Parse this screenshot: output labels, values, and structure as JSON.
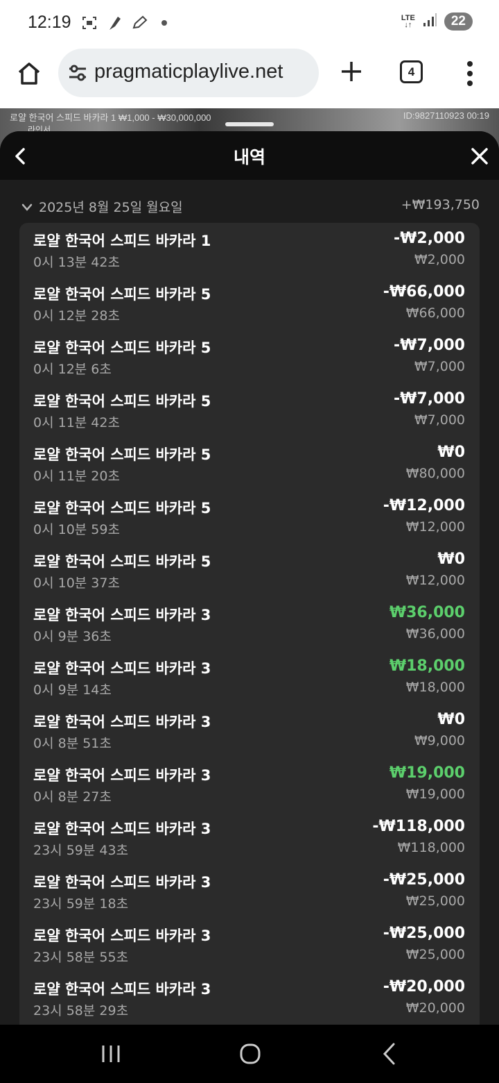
{
  "status_bar": {
    "time": "12:19",
    "network": "LTE",
    "battery": "22"
  },
  "browser": {
    "url": "pragmaticplaylive.net",
    "tab_count": "4"
  },
  "game": {
    "info": "로얄 한국어 스피드 바카라 1  ₩1,000 - ₩30,000,000",
    "id": "ID:9827110923  00:19",
    "sub": "라인서"
  },
  "sheet": {
    "title": "내역",
    "day": {
      "label": "2025년 8월 25일 월요일",
      "total": "+₩193,750"
    },
    "items": [
      {
        "name": "로얄 한국어 스피드 바카라 1",
        "time": "0시 13분 42초",
        "amount": "-₩2,000",
        "stake": "₩2,000",
        "win": false
      },
      {
        "name": "로얄 한국어 스피드 바카라 5",
        "time": "0시 12분 28초",
        "amount": "-₩66,000",
        "stake": "₩66,000",
        "win": false
      },
      {
        "name": "로얄 한국어 스피드 바카라 5",
        "time": "0시 12분 6초",
        "amount": "-₩7,000",
        "stake": "₩7,000",
        "win": false
      },
      {
        "name": "로얄 한국어 스피드 바카라 5",
        "time": "0시 11분 42초",
        "amount": "-₩7,000",
        "stake": "₩7,000",
        "win": false
      },
      {
        "name": "로얄 한국어 스피드 바카라 5",
        "time": "0시 11분 20초",
        "amount": "₩0",
        "stake": "₩80,000",
        "win": false
      },
      {
        "name": "로얄 한국어 스피드 바카라 5",
        "time": "0시 10분 59초",
        "amount": "-₩12,000",
        "stake": "₩12,000",
        "win": false
      },
      {
        "name": "로얄 한국어 스피드 바카라 5",
        "time": "0시 10분 37초",
        "amount": "₩0",
        "stake": "₩12,000",
        "win": false
      },
      {
        "name": "로얄 한국어 스피드 바카라 3",
        "time": "0시 9분 36초",
        "amount": "₩36,000",
        "stake": "₩36,000",
        "win": true
      },
      {
        "name": "로얄 한국어 스피드 바카라 3",
        "time": "0시 9분 14초",
        "amount": "₩18,000",
        "stake": "₩18,000",
        "win": true
      },
      {
        "name": "로얄 한국어 스피드 바카라 3",
        "time": "0시 8분 51초",
        "amount": "₩0",
        "stake": "₩9,000",
        "win": false
      },
      {
        "name": "로얄 한국어 스피드 바카라 3",
        "time": "0시 8분 27초",
        "amount": "₩19,000",
        "stake": "₩19,000",
        "win": true
      },
      {
        "name": "로얄 한국어 스피드 바카라 3",
        "time": "23시 59분 43초",
        "amount": "-₩118,000",
        "stake": "₩118,000",
        "win": false
      },
      {
        "name": "로얄 한국어 스피드 바카라 3",
        "time": "23시 59분 18초",
        "amount": "-₩25,000",
        "stake": "₩25,000",
        "win": false
      },
      {
        "name": "로얄 한국어 스피드 바카라 3",
        "time": "23시 58분 55초",
        "amount": "-₩25,000",
        "stake": "₩25,000",
        "win": false
      },
      {
        "name": "로얄 한국어 스피드 바카라 3",
        "time": "23시 58분 29초",
        "amount": "-₩20,000",
        "stake": "₩20,000",
        "win": false
      }
    ]
  },
  "colors": {
    "win": "#5ccf6c",
    "sheet_bg": "#1d1d1d",
    "card_bg": "#2b2b2b"
  }
}
